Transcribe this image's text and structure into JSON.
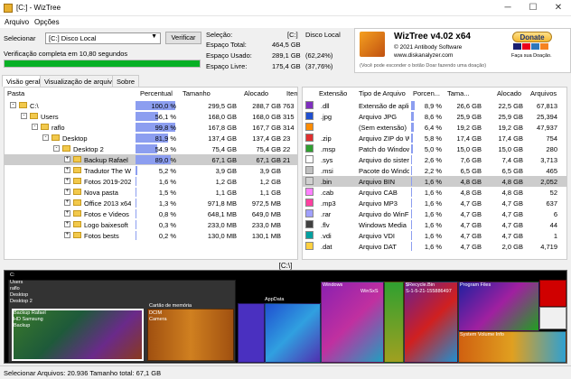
{
  "window": {
    "title": "[C:] - WizTree",
    "min": "─",
    "max": "☐",
    "close": "✕"
  },
  "menu": [
    "Arquivo",
    "Opções"
  ],
  "top": {
    "select_label": "Selecionar",
    "drive": "[C:] Disco Local",
    "verify": "Verificar",
    "status": "Verificação completa em 10,80 segundos",
    "progress": 1.0
  },
  "info": {
    "sel_label": "Seleção:",
    "sel_drive": "[C:]",
    "sel_name": "Disco Local",
    "rows": [
      {
        "k": "Espaço Total:",
        "v": "464,5 GB",
        "p": ""
      },
      {
        "k": "Espaço Usado:",
        "v": "289,1 GB",
        "p": "(62,24%)"
      },
      {
        "k": "Espaço Livre:",
        "v": "175,4 GB",
        "p": "(37,76%)"
      }
    ]
  },
  "logo": {
    "name": "WizTree v4.02 x64",
    "copy": "© 2021 Antibody Software",
    "url": "www.diskanalyzer.com",
    "note": "(Você pode esconder o botão Doar fazendo uma doação)",
    "donate": "Donate",
    "donate_sub": "Faça sua Doação."
  },
  "tabs": [
    "Visão geral",
    "Visualização de arquivo",
    "Sobre"
  ],
  "left": {
    "headers": [
      "Pasta",
      "Percentual",
      "Tamanho",
      "Alocado",
      "Iten"
    ],
    "rows": [
      {
        "indent": 0,
        "exp": "-",
        "name": "C:\\",
        "pct": "100,0 %",
        "p": 1.0,
        "size": "299,5 GB",
        "alloc": "288,7 GB",
        "items": "763"
      },
      {
        "indent": 1,
        "exp": "-",
        "name": "Users",
        "pct": "56,1 %",
        "p": 0.561,
        "size": "168,0 GB",
        "alloc": "168,0 GB",
        "items": "315"
      },
      {
        "indent": 2,
        "exp": "-",
        "name": "raflo",
        "pct": "99,8 %",
        "p": 0.998,
        "size": "167,8 GB",
        "alloc": "167,7 GB",
        "items": "314"
      },
      {
        "indent": 3,
        "exp": "-",
        "name": "Desktop",
        "pct": "81,9 %",
        "p": 0.819,
        "size": "137,4 GB",
        "alloc": "137,4 GB",
        "items": "23"
      },
      {
        "indent": 4,
        "exp": "-",
        "name": "Desktop 2",
        "pct": "54,9 %",
        "p": 0.549,
        "size": "75,4 GB",
        "alloc": "75,4 GB",
        "items": "22"
      },
      {
        "indent": 5,
        "exp": "+",
        "name": "Backup Rafael",
        "pct": "89,0 %",
        "p": 0.89,
        "size": "67,1 GB",
        "alloc": "67,1 GB",
        "items": "21",
        "sel": true
      },
      {
        "indent": 5,
        "exp": "+",
        "name": "Tradutor The Wi",
        "pct": "5,2 %",
        "p": 0.052,
        "size": "3,9 GB",
        "alloc": "3,9 GB",
        "items": ""
      },
      {
        "indent": 5,
        "exp": "+",
        "name": "Fotos 2019-202(",
        "pct": "1,6 %",
        "p": 0.016,
        "size": "1,2 GB",
        "alloc": "1,2 GB",
        "items": ""
      },
      {
        "indent": 5,
        "exp": "+",
        "name": "Nova pasta",
        "pct": "1,5 %",
        "p": 0.015,
        "size": "1,1 GB",
        "alloc": "1,1 GB",
        "items": ""
      },
      {
        "indent": 5,
        "exp": "+",
        "name": "Office 2013 x64",
        "pct": "1,3 %",
        "p": 0.013,
        "size": "971,8 MB",
        "alloc": "972,5 MB",
        "items": ""
      },
      {
        "indent": 5,
        "exp": "+",
        "name": "Fotos e Videos J",
        "pct": "0,8 %",
        "p": 0.008,
        "size": "648,1 MB",
        "alloc": "649,0 MB",
        "items": ""
      },
      {
        "indent": 5,
        "exp": "+",
        "name": "Logo baixesoft",
        "pct": "0,3 %",
        "p": 0.003,
        "size": "233,0 MB",
        "alloc": "233,0 MB",
        "items": ""
      },
      {
        "indent": 5,
        "exp": "+",
        "name": "Fotos bests",
        "pct": "0,2 %",
        "p": 0.002,
        "size": "130,0 MB",
        "alloc": "130,1 MB",
        "items": ""
      }
    ]
  },
  "right": {
    "headers": [
      "Extensão",
      "Tipo de Arquivo",
      "Porcen...",
      "Tama...",
      "Alocado",
      "Arquivos"
    ],
    "rows": [
      {
        "color": "#7f2fbf",
        "ext": ".dll",
        "type": "Extensão de aplic",
        "pct": "8,9 %",
        "p": 0.089,
        "size": "26,6 GB",
        "alloc": "22,5 GB",
        "files": "67,813"
      },
      {
        "color": "#2050d0",
        "ext": ".jpg",
        "type": "Arquivo JPG",
        "pct": "8,6 %",
        "p": 0.086,
        "size": "25,9 GB",
        "alloc": "25,9 GB",
        "files": "25,394"
      },
      {
        "color": "#ff8c00",
        "ext": "",
        "type": "(Sem extensão)",
        "pct": "6,4 %",
        "p": 0.064,
        "size": "19,2 GB",
        "alloc": "19,2 GB",
        "files": "47,937"
      },
      {
        "color": "#e03030",
        "ext": ".zip",
        "type": "Arquivo ZIP do W",
        "pct": "5,8 %",
        "p": 0.058,
        "size": "17,4 GB",
        "alloc": "17,4 GB",
        "files": "754"
      },
      {
        "color": "#30a030",
        "ext": ".msp",
        "type": "Patch do Window",
        "pct": "5,0 %",
        "p": 0.05,
        "size": "15,0 GB",
        "alloc": "15,0 GB",
        "files": "280"
      },
      {
        "color": "#ffffff",
        "ext": ".sys",
        "type": "Arquivo do sister",
        "pct": "2,6 %",
        "p": 0.026,
        "size": "7,6 GB",
        "alloc": "7,4 GB",
        "files": "3,713"
      },
      {
        "color": "#c0c0c0",
        "ext": ".msi",
        "type": "Pacote do Windo",
        "pct": "2,2 %",
        "p": 0.022,
        "size": "6,5 GB",
        "alloc": "6,5 GB",
        "files": "465"
      },
      {
        "color": "#d0d0d0",
        "ext": ".bin",
        "type": "Arquivo BIN",
        "pct": "1,6 %",
        "p": 0.016,
        "size": "4,8 GB",
        "alloc": "4,8 GB",
        "files": "2,052",
        "sel": true
      },
      {
        "color": "#ff80ff",
        "ext": ".cab",
        "type": "Arquivo CAB",
        "pct": "1,6 %",
        "p": 0.016,
        "size": "4,8 GB",
        "alloc": "4,8 GB",
        "files": "52"
      },
      {
        "color": "#ff40a0",
        "ext": ".mp3",
        "type": "Arquivo MP3",
        "pct": "1,6 %",
        "p": 0.016,
        "size": "4,7 GB",
        "alloc": "4,7 GB",
        "files": "637"
      },
      {
        "color": "#a0a0ff",
        "ext": ".rar",
        "type": "Arquivo do WinF",
        "pct": "1,6 %",
        "p": 0.016,
        "size": "4,7 GB",
        "alloc": "4,7 GB",
        "files": "6"
      },
      {
        "color": "#404040",
        "ext": ".flv",
        "type": "Windows Media",
        "pct": "1,6 %",
        "p": 0.016,
        "size": "4,7 GB",
        "alloc": "4,7 GB",
        "files": "44"
      },
      {
        "color": "#00a0a0",
        "ext": ".vdi",
        "type": "Arquivo VDI",
        "pct": "1,6 %",
        "p": 0.016,
        "size": "4,7 GB",
        "alloc": "4,7 GB",
        "files": "1"
      },
      {
        "color": "#ffd040",
        "ext": ".dat",
        "type": "Arquivo DAT",
        "pct": "1,6 %",
        "p": 0.016,
        "size": "4,7 GB",
        "alloc": "2,0 GB",
        "files": "4,719"
      }
    ]
  },
  "path_label": "[C:\\]",
  "treemap_labels": {
    "c": "C:",
    "users": "Users",
    "raflo": "raflo",
    "desktop": "Desktop",
    "desktop2": "Desktop 2",
    "backup": "Backup Rafael",
    "hd": "HD Samsung",
    "backup2": "Backup",
    "cartao": "Cartão de memória",
    "dcim": "DCIM",
    "camera": "Camera",
    "appdata": "AppData",
    "windows": "Windows",
    "winsxs": "WinSxS",
    "recycle": "$Recycle.Bin",
    "sid": "S-1-5-21-155886497",
    "progfiles": "Program Files",
    "svi": "System Volume Info"
  },
  "statusbar": "Selecionar Arquivos: 20.936  Tamanho total: 67,1 GB"
}
